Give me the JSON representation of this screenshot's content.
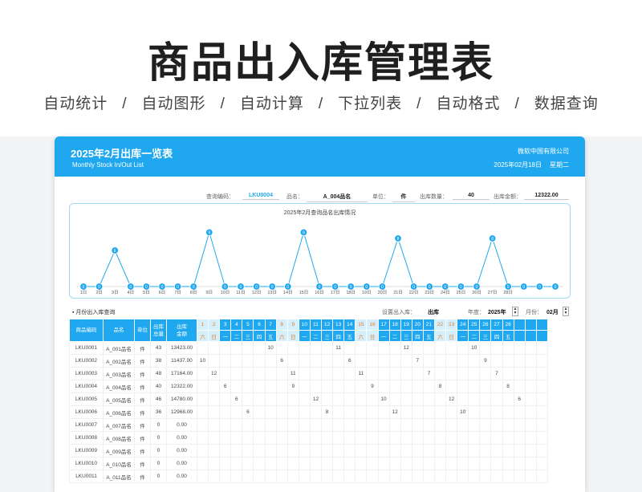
{
  "hero": {
    "title": "商品出入库管理表",
    "features": [
      "自动统计",
      "/",
      "自动图形",
      "/",
      "自动计算",
      "/",
      "下拉列表",
      "/",
      "自动格式",
      "/",
      "数据查询"
    ]
  },
  "banner": {
    "title": "2025年2月出库一览表",
    "subtitle": "Monthly Stock In/Out List",
    "company": "微软中国有限公司",
    "date": "2025年02月18日",
    "weekday": "星期二"
  },
  "query": {
    "code_label": "查询编码：",
    "code_value": "LKU0004",
    "name_label": "品名：",
    "name_value": "A_004品名",
    "unit_label": "单位：",
    "unit_value": "件",
    "qty_label": "出库数量：",
    "qty_value": "40",
    "amount_label": "出库金额：",
    "amount_value": "12322.00"
  },
  "section": {
    "title": "▪ 月份出入库查询",
    "mode_label": "设置出入库：",
    "mode_value": "出库",
    "year_label": "年度：",
    "year_value": "2025年",
    "month_label": "月份：",
    "month_value": "02月"
  },
  "colors": {
    "accent": "#1fa8ef",
    "weekend": "#e07b2a"
  },
  "chart_data": {
    "type": "line",
    "title": "2025年2月查询品名出库情况",
    "x": [
      "1日",
      "2日",
      "3日",
      "4日",
      "5日",
      "6日",
      "7日",
      "8日",
      "9日",
      "10日",
      "11日",
      "12日",
      "13日",
      "14日",
      "15日",
      "16日",
      "17日",
      "18日",
      "19日",
      "20日",
      "21日",
      "22日",
      "23日",
      "24日",
      "25日",
      "26日",
      "27日",
      "28日",
      "",
      "",
      ""
    ],
    "values": [
      0,
      0,
      6,
      0,
      0,
      0,
      0,
      0,
      9,
      0,
      0,
      0,
      0,
      0,
      9,
      0,
      0,
      0,
      0,
      0,
      8,
      0,
      0,
      0,
      0,
      0,
      8,
      0,
      0,
      0,
      0
    ],
    "ylim": [
      0,
      10
    ],
    "grid": false,
    "legend": "none"
  },
  "table": {
    "headers": {
      "code": "商品编码",
      "name": "品名",
      "unit": "单位",
      "qty": "出库\n总量",
      "amount": "出库\n金额"
    },
    "days": [
      "1",
      "2",
      "3",
      "4",
      "5",
      "6",
      "7",
      "8",
      "9",
      "10",
      "11",
      "12",
      "13",
      "14",
      "15",
      "16",
      "17",
      "18",
      "19",
      "20",
      "21",
      "22",
      "23",
      "24",
      "25",
      "26",
      "27",
      "28",
      "",
      "",
      ""
    ],
    "weekdays": [
      "六",
      "日",
      "一",
      "二",
      "三",
      "四",
      "五",
      "六",
      "日",
      "一",
      "二",
      "三",
      "四",
      "五",
      "六",
      "日",
      "一",
      "二",
      "三",
      "四",
      "五",
      "六",
      "日",
      "一",
      "二",
      "三",
      "四",
      "五",
      "",
      "",
      ""
    ],
    "weekend_cols": [
      0,
      1,
      7,
      8,
      14,
      15,
      21,
      22
    ],
    "rows": [
      {
        "code": "LKU0001",
        "name": "A_001品名",
        "unit": "件",
        "qty": "43",
        "amount": "13423.00",
        "cells": {
          "6": "10",
          "12": "11",
          "18": "12",
          "24": "10"
        }
      },
      {
        "code": "LKU0002",
        "name": "A_002品名",
        "unit": "件",
        "qty": "38",
        "amount": "11437.00",
        "cells": {
          "0": "10",
          "7": "6",
          "13": "6",
          "19": "7",
          "25": "9"
        }
      },
      {
        "code": "LKU0003",
        "name": "A_003品名",
        "unit": "件",
        "qty": "48",
        "amount": "17164.00",
        "cells": {
          "1": "12",
          "8": "11",
          "14": "11",
          "20": "7",
          "26": "7"
        }
      },
      {
        "code": "LKU0004",
        "name": "A_004品名",
        "unit": "件",
        "qty": "40",
        "amount": "12322.00",
        "cells": {
          "2": "6",
          "8": "9",
          "15": "9",
          "21": "8",
          "27": "8"
        }
      },
      {
        "code": "LKU0005",
        "name": "A_005品名",
        "unit": "件",
        "qty": "46",
        "amount": "14780.00",
        "cells": {
          "3": "6",
          "10": "12",
          "16": "10",
          "22": "12",
          "28": "6"
        }
      },
      {
        "code": "LKU0006",
        "name": "A_006品名",
        "unit": "件",
        "qty": "36",
        "amount": "12968.00",
        "cells": {
          "4": "6",
          "11": "8",
          "17": "12",
          "23": "10"
        }
      },
      {
        "code": "LKU0007",
        "name": "A_007品名",
        "unit": "件",
        "qty": "0",
        "amount": "0.00",
        "cells": {}
      },
      {
        "code": "LKU0008",
        "name": "A_008品名",
        "unit": "件",
        "qty": "0",
        "amount": "0.00",
        "cells": {}
      },
      {
        "code": "LKU0009",
        "name": "A_009品名",
        "unit": "件",
        "qty": "0",
        "amount": "0.00",
        "cells": {}
      },
      {
        "code": "LKU0010",
        "name": "A_010品名",
        "unit": "件",
        "qty": "0",
        "amount": "0.00",
        "cells": {}
      },
      {
        "code": "LKU0011",
        "name": "A_011品名",
        "unit": "件",
        "qty": "0",
        "amount": "0.00",
        "cells": {}
      }
    ]
  }
}
